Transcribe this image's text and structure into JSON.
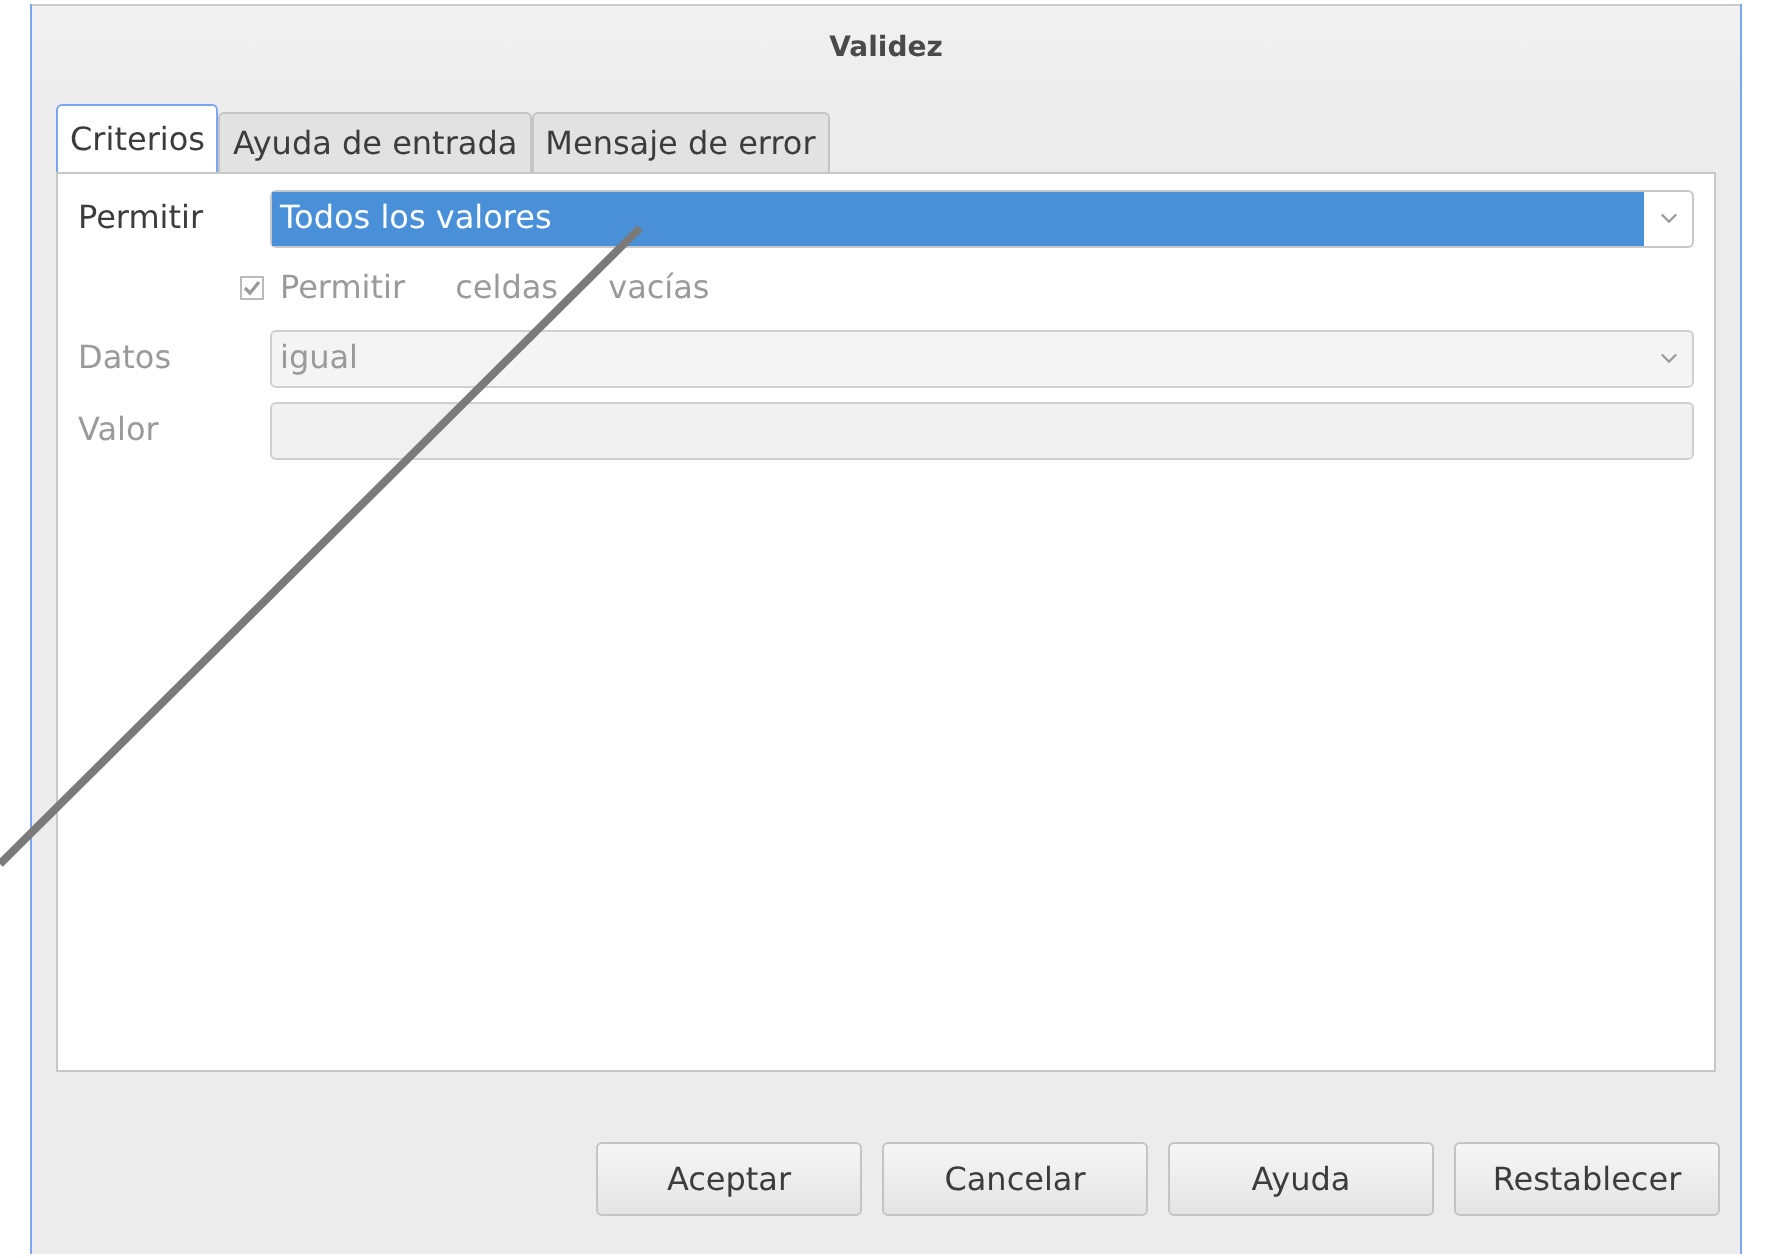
{
  "window": {
    "title": "Validez"
  },
  "tabs": [
    {
      "label": "Criterios",
      "selected": true
    },
    {
      "label": "Ayuda de entrada",
      "selected": false
    },
    {
      "label": "Mensaje de error",
      "selected": false
    }
  ],
  "fields": [
    {
      "kind": "dropdown",
      "label": "Permitir",
      "value": "Todos los valores",
      "disabled": false,
      "highlighted": true
    },
    {
      "kind": "checkbox",
      "label": "Permitir celdas vacías",
      "checked": true,
      "disabled": true
    },
    {
      "kind": "dropdown",
      "label": "Datos",
      "value": "igual",
      "disabled": true,
      "highlighted": false
    },
    {
      "kind": "text",
      "label": "Valor",
      "disabled": true
    }
  ],
  "buttons": [
    "Aceptar",
    "Cancelar",
    "Ayuda",
    "Restablecer"
  ]
}
